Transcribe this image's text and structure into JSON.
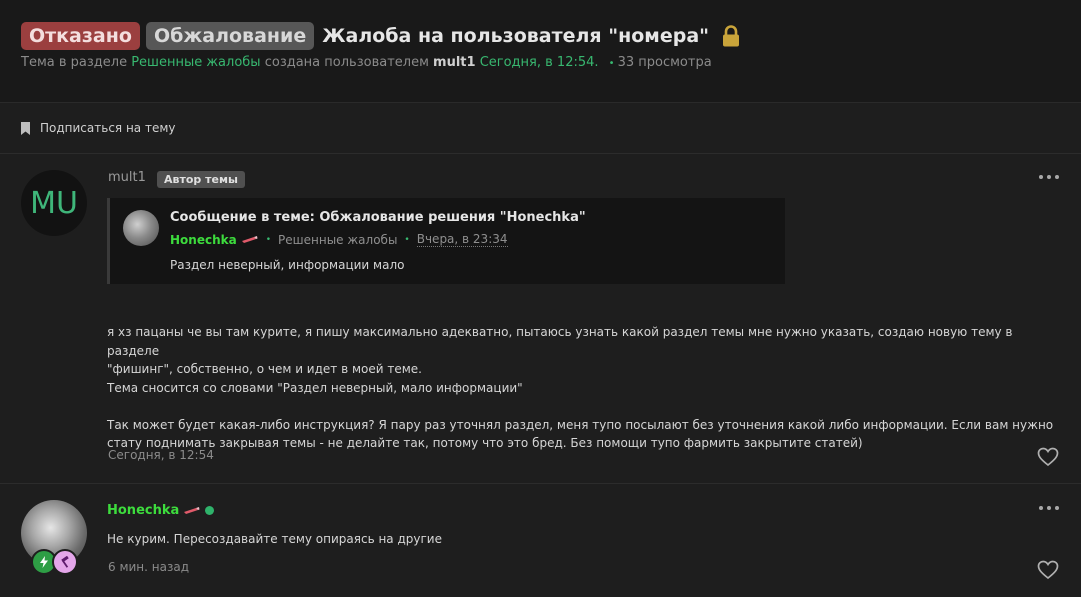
{
  "header": {
    "prefix_refused": "Отказано",
    "prefix_appeal": "Обжалование",
    "title": "Жалоба на пользователя \"номера\"",
    "meta_part1": "Тема в разделе",
    "meta_section": "Решенные жалобы",
    "meta_part2": "создана пользователем",
    "meta_user": "mult1",
    "meta_date": "Сегодня, в 12:54.",
    "meta_views": "33 просмотра"
  },
  "subscribe_label": "Подписаться на тему",
  "post1": {
    "avatar_initials": "MU",
    "username": "mult1",
    "author_badge": "Автор темы",
    "quote": {
      "title": "Сообщение в теме: Обжалование решения \"Honechka\"",
      "author": "Honechka",
      "section": "Решенные жалобы",
      "date": "Вчера, в 23:34",
      "text": "Раздел неверный, информации мало"
    },
    "body_line1": "я хз пацаны че вы там курите, я пишу максимально адекватно, пытаюсь узнать какой раздел темы мне нужно указать, создаю новую тему в разделе",
    "body_line2": "\"фишинг\", собственно, о чем и идет в моей теме.",
    "body_line3": "Тема сносится со словами \"Раздел неверный, мало информации\"",
    "body_line4": "Так может будет какая-либо инструкция? Я пару раз уточнял раздел, меня тупо посылают без уточнения какой либо информации. Если вам нужно",
    "body_line5": "стату поднимать закрывая темы - не делайте так, потому что это бред. Без помощи тупо фармить закрытите статей)",
    "time": "Сегодня, в 12:54"
  },
  "post2": {
    "username": "Honechka",
    "text": "Не курим. Пересоздавайте тему опираясь на другие",
    "time": "6 мин. назад"
  },
  "colors": {
    "background": "#191919",
    "panel": "#1e1e1e",
    "refused_prefix": "#9b3f3f",
    "appeal_prefix": "#575757",
    "link_green": "#38b870",
    "username_green": "#3ddc3d",
    "lock_gold": "#c9a43a"
  },
  "icons": [
    "lock-icon",
    "bookmark-icon",
    "more-options-icon",
    "heart-icon",
    "pencil-icon",
    "online-status-icon",
    "lightning-badge-icon",
    "hammer-badge-icon"
  ]
}
